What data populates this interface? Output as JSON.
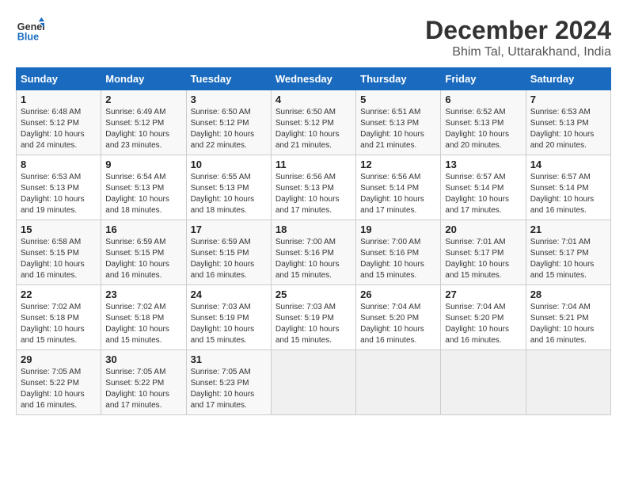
{
  "logo": {
    "line1": "General",
    "line2": "Blue"
  },
  "title": "December 2024",
  "location": "Bhim Tal, Uttarakhand, India",
  "headers": [
    "Sunday",
    "Monday",
    "Tuesday",
    "Wednesday",
    "Thursday",
    "Friday",
    "Saturday"
  ],
  "weeks": [
    [
      {
        "day": "1",
        "info": "Sunrise: 6:48 AM\nSunset: 5:12 PM\nDaylight: 10 hours\nand 24 minutes."
      },
      {
        "day": "2",
        "info": "Sunrise: 6:49 AM\nSunset: 5:12 PM\nDaylight: 10 hours\nand 23 minutes."
      },
      {
        "day": "3",
        "info": "Sunrise: 6:50 AM\nSunset: 5:12 PM\nDaylight: 10 hours\nand 22 minutes."
      },
      {
        "day": "4",
        "info": "Sunrise: 6:50 AM\nSunset: 5:12 PM\nDaylight: 10 hours\nand 21 minutes."
      },
      {
        "day": "5",
        "info": "Sunrise: 6:51 AM\nSunset: 5:13 PM\nDaylight: 10 hours\nand 21 minutes."
      },
      {
        "day": "6",
        "info": "Sunrise: 6:52 AM\nSunset: 5:13 PM\nDaylight: 10 hours\nand 20 minutes."
      },
      {
        "day": "7",
        "info": "Sunrise: 6:53 AM\nSunset: 5:13 PM\nDaylight: 10 hours\nand 20 minutes."
      }
    ],
    [
      {
        "day": "8",
        "info": "Sunrise: 6:53 AM\nSunset: 5:13 PM\nDaylight: 10 hours\nand 19 minutes."
      },
      {
        "day": "9",
        "info": "Sunrise: 6:54 AM\nSunset: 5:13 PM\nDaylight: 10 hours\nand 18 minutes."
      },
      {
        "day": "10",
        "info": "Sunrise: 6:55 AM\nSunset: 5:13 PM\nDaylight: 10 hours\nand 18 minutes."
      },
      {
        "day": "11",
        "info": "Sunrise: 6:56 AM\nSunset: 5:13 PM\nDaylight: 10 hours\nand 17 minutes."
      },
      {
        "day": "12",
        "info": "Sunrise: 6:56 AM\nSunset: 5:14 PM\nDaylight: 10 hours\nand 17 minutes."
      },
      {
        "day": "13",
        "info": "Sunrise: 6:57 AM\nSunset: 5:14 PM\nDaylight: 10 hours\nand 17 minutes."
      },
      {
        "day": "14",
        "info": "Sunrise: 6:57 AM\nSunset: 5:14 PM\nDaylight: 10 hours\nand 16 minutes."
      }
    ],
    [
      {
        "day": "15",
        "info": "Sunrise: 6:58 AM\nSunset: 5:15 PM\nDaylight: 10 hours\nand 16 minutes."
      },
      {
        "day": "16",
        "info": "Sunrise: 6:59 AM\nSunset: 5:15 PM\nDaylight: 10 hours\nand 16 minutes."
      },
      {
        "day": "17",
        "info": "Sunrise: 6:59 AM\nSunset: 5:15 PM\nDaylight: 10 hours\nand 16 minutes."
      },
      {
        "day": "18",
        "info": "Sunrise: 7:00 AM\nSunset: 5:16 PM\nDaylight: 10 hours\nand 15 minutes."
      },
      {
        "day": "19",
        "info": "Sunrise: 7:00 AM\nSunset: 5:16 PM\nDaylight: 10 hours\nand 15 minutes."
      },
      {
        "day": "20",
        "info": "Sunrise: 7:01 AM\nSunset: 5:17 PM\nDaylight: 10 hours\nand 15 minutes."
      },
      {
        "day": "21",
        "info": "Sunrise: 7:01 AM\nSunset: 5:17 PM\nDaylight: 10 hours\nand 15 minutes."
      }
    ],
    [
      {
        "day": "22",
        "info": "Sunrise: 7:02 AM\nSunset: 5:18 PM\nDaylight: 10 hours\nand 15 minutes."
      },
      {
        "day": "23",
        "info": "Sunrise: 7:02 AM\nSunset: 5:18 PM\nDaylight: 10 hours\nand 15 minutes."
      },
      {
        "day": "24",
        "info": "Sunrise: 7:03 AM\nSunset: 5:19 PM\nDaylight: 10 hours\nand 15 minutes."
      },
      {
        "day": "25",
        "info": "Sunrise: 7:03 AM\nSunset: 5:19 PM\nDaylight: 10 hours\nand 15 minutes."
      },
      {
        "day": "26",
        "info": "Sunrise: 7:04 AM\nSunset: 5:20 PM\nDaylight: 10 hours\nand 16 minutes."
      },
      {
        "day": "27",
        "info": "Sunrise: 7:04 AM\nSunset: 5:20 PM\nDaylight: 10 hours\nand 16 minutes."
      },
      {
        "day": "28",
        "info": "Sunrise: 7:04 AM\nSunset: 5:21 PM\nDaylight: 10 hours\nand 16 minutes."
      }
    ],
    [
      {
        "day": "29",
        "info": "Sunrise: 7:05 AM\nSunset: 5:22 PM\nDaylight: 10 hours\nand 16 minutes."
      },
      {
        "day": "30",
        "info": "Sunrise: 7:05 AM\nSunset: 5:22 PM\nDaylight: 10 hours\nand 17 minutes."
      },
      {
        "day": "31",
        "info": "Sunrise: 7:05 AM\nSunset: 5:23 PM\nDaylight: 10 hours\nand 17 minutes."
      },
      {
        "day": "",
        "info": ""
      },
      {
        "day": "",
        "info": ""
      },
      {
        "day": "",
        "info": ""
      },
      {
        "day": "",
        "info": ""
      }
    ]
  ]
}
